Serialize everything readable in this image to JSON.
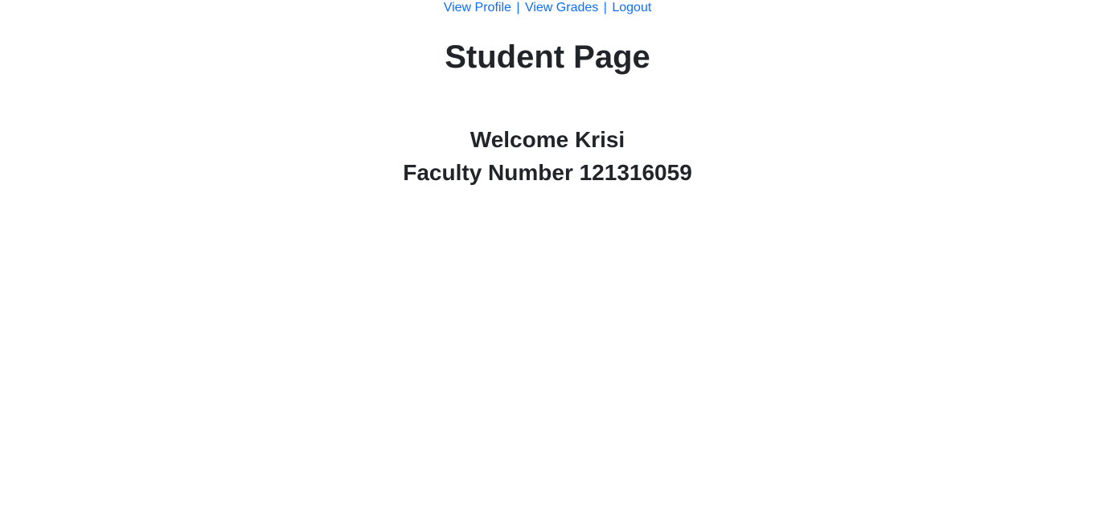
{
  "nav": {
    "view_profile": "View Profile",
    "separator_1": "|",
    "view_grades": "View Grades",
    "separator_2": "|",
    "logout": "Logout"
  },
  "main": {
    "title": "Student Page",
    "welcome_text": "Welcome Krisi",
    "faculty_text": "Faculty Number 121316059"
  },
  "colors": {
    "link": "#0d6efd",
    "text": "#212529",
    "background": "#ffffff"
  }
}
